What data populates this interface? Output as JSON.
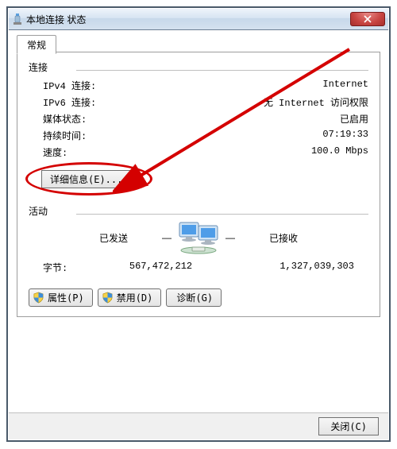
{
  "window": {
    "title": "本地连接 状态"
  },
  "tabs": {
    "general": "常规"
  },
  "connection": {
    "group_label": "连接",
    "rows": {
      "ipv4_label": "IPv4 连接:",
      "ipv4_value": "Internet",
      "ipv6_label": "IPv6 连接:",
      "ipv6_value": "无 Internet 访问权限",
      "media_label": "媒体状态:",
      "media_value": "已启用",
      "duration_label": "持续时间:",
      "duration_value": "07:19:33",
      "speed_label": "速度:",
      "speed_value": "100.0 Mbps"
    },
    "details_button": "详细信息(E)..."
  },
  "activity": {
    "group_label": "活动",
    "sent_label": "已发送",
    "received_label": "已接收",
    "bytes_label": "字节:",
    "sent_bytes": "567,472,212",
    "received_bytes": "1,327,039,303"
  },
  "buttons": {
    "properties": "属性(P)",
    "disable": "禁用(D)",
    "diagnose": "诊断(G)"
  },
  "footer": {
    "close": "关闭(C)"
  },
  "annotation": {
    "color": "#d40000"
  }
}
